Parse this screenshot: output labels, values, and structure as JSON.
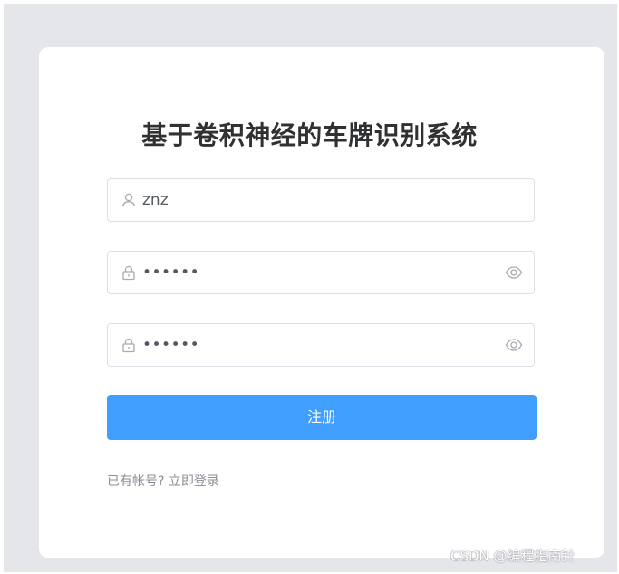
{
  "page": {
    "title": "基于卷积神经的车牌识别系统"
  },
  "form": {
    "username": {
      "value": "znz",
      "icon": "user-icon"
    },
    "password": {
      "value": "••••••",
      "icon": "lock-icon",
      "toggle_icon": "eye-icon"
    },
    "confirm_password": {
      "value": "••••••",
      "icon": "lock-icon",
      "toggle_icon": "eye-icon"
    },
    "submit_label": "注册",
    "login_link": "已有帐号? 立即登录"
  },
  "watermark": "CSDN @编程指南针",
  "colors": {
    "primary": "#409eff",
    "backdrop": "#e4e6ea",
    "title": "#303133",
    "border": "#dcdfe6",
    "muted": "#8a8e96"
  }
}
